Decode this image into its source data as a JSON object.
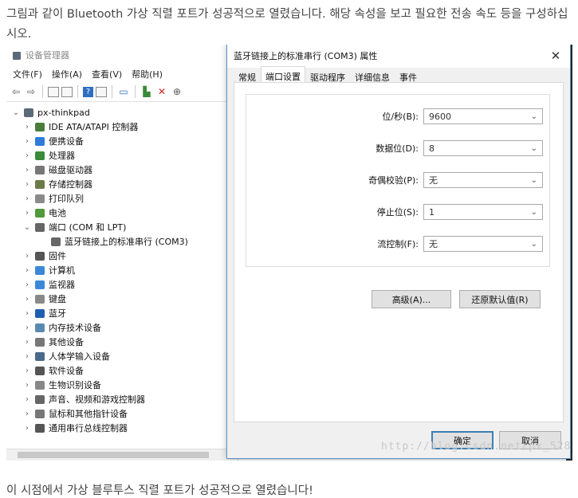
{
  "article": {
    "intro": "그림과 같이 Bluetooth 가상 직렬 포트가 성공적으로 열렸습니다. 해당 속성을 보고 필요한 전송 속도 등을 구성하십시오.",
    "outro": "이 시점에서 가상 블루투스 직렬 포트가 성공적으로 열렸습니다!"
  },
  "device_manager": {
    "title": "设备管理器",
    "menu": [
      "文件(F)",
      "操作(A)",
      "查看(V)",
      "帮助(H)"
    ],
    "root": "px-thinkpad",
    "items": [
      {
        "label": "IDE ATA/ATAPI 控制器",
        "icon_color": "#4a7d3a",
        "icon": "ide-controller-icon"
      },
      {
        "label": "便携设备",
        "icon_color": "#2f7bd8",
        "icon": "portable-device-icon"
      },
      {
        "label": "处理器",
        "icon_color": "#3a8a3a",
        "icon": "processor-icon"
      },
      {
        "label": "磁盘驱动器",
        "icon_color": "#777777",
        "icon": "disk-drive-icon"
      },
      {
        "label": "存储控制器",
        "icon_color": "#6c7a4a",
        "icon": "storage-controller-icon"
      },
      {
        "label": "打印队列",
        "icon_color": "#8a8a8a",
        "icon": "printer-icon"
      },
      {
        "label": "电池",
        "icon_color": "#4f9a3a",
        "icon": "battery-icon"
      },
      {
        "label": "端口 (COM 和 LPT)",
        "icon_color": "#666666",
        "icon": "port-icon",
        "expanded": true
      },
      {
        "label": "固件",
        "icon_color": "#555555",
        "icon": "firmware-icon"
      },
      {
        "label": "计算机",
        "icon_color": "#3b88d8",
        "icon": "computer-icon"
      },
      {
        "label": "监视器",
        "icon_color": "#3b88d8",
        "icon": "monitor-icon"
      },
      {
        "label": "键盘",
        "icon_color": "#888888",
        "icon": "keyboard-icon"
      },
      {
        "label": "蓝牙",
        "icon_color": "#1f5fb0",
        "icon": "bluetooth-icon"
      },
      {
        "label": "内存技术设备",
        "icon_color": "#5a8ab0",
        "icon": "memory-device-icon"
      },
      {
        "label": "其他设备",
        "icon_color": "#777777",
        "icon": "other-devices-icon"
      },
      {
        "label": "人体学输入设备",
        "icon_color": "#4a6a8a",
        "icon": "hid-icon"
      },
      {
        "label": "软件设备",
        "icon_color": "#555555",
        "icon": "software-device-icon"
      },
      {
        "label": "生物识别设备",
        "icon_color": "#888888",
        "icon": "biometric-icon"
      },
      {
        "label": "声音、视频和游戏控制器",
        "icon_color": "#666666",
        "icon": "sound-icon"
      },
      {
        "label": "鼠标和其他指针设备",
        "icon_color": "#777777",
        "icon": "mouse-icon"
      },
      {
        "label": "通用串行总线控制器",
        "icon_color": "#555555",
        "icon": "usb-icon"
      }
    ],
    "port_child": "蓝牙链接上的标准串行 (COM3)"
  },
  "dialog": {
    "title": "蓝牙链接上的标准串行 (COM3) 属性",
    "tabs": [
      "常规",
      "端口设置",
      "驱动程序",
      "详细信息",
      "事件"
    ],
    "active_tab": "端口设置",
    "fields": [
      {
        "label": "位/秒(B):",
        "value": "9600"
      },
      {
        "label": "数据位(D):",
        "value": "8"
      },
      {
        "label": "奇偶校验(P):",
        "value": "无"
      },
      {
        "label": "停止位(S):",
        "value": "1"
      },
      {
        "label": "流控制(F):",
        "value": "无"
      }
    ],
    "advanced": "高级(A)...",
    "restore": "还原默认值(R)",
    "ok": "确定",
    "cancel": "取消"
  },
  "watermark": "http://blog.csdn.net/px_528"
}
